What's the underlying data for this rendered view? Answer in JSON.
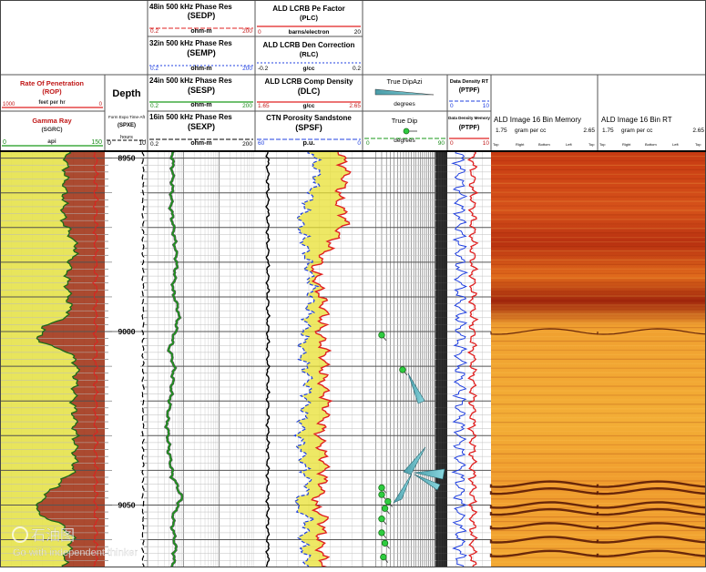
{
  "header": {
    "rop": {
      "title": "Rate Of Penetration",
      "mnemonic": "(ROP)",
      "unit": "feet per hr",
      "left": "1000",
      "right": "0",
      "color": "#e02020"
    },
    "gr": {
      "title": "Gamma Ray",
      "mnemonic": "(SGRC)",
      "unit": "api",
      "left": "0",
      "right": "150",
      "color": "#1a9a1a"
    },
    "depth_title": "Depth",
    "pore": {
      "title": "Form Expo Time-Aft",
      "mnemonic": "(SPXE)",
      "unit": "hours",
      "left": "0",
      "right": "10"
    },
    "sedp": {
      "title": "48in 500 kHz Phase Res",
      "mnemonic": "(SEDP)",
      "unit": "ohm-m",
      "left": "0.2",
      "right": "200",
      "color": "#e02020"
    },
    "semp": {
      "title": "32in 500 kHz Phase Res",
      "mnemonic": "(SEMP)",
      "unit": "ohm-m",
      "left": "0.2",
      "right": "200",
      "color": "#2040e0"
    },
    "sesp": {
      "title": "24in 500 kHz Phase Res",
      "mnemonic": "(SESP)",
      "unit": "ohm-m",
      "left": "0.2",
      "right": "200",
      "color": "#1a9a1a"
    },
    "sexp": {
      "title": "16in 500 kHz Phase Res",
      "mnemonic": "(SEXP)",
      "unit": "ohm-m",
      "left": "0.2",
      "right": "200",
      "color": "#000000"
    },
    "plc": {
      "title": "ALD LCRB Pe Factor",
      "mnemonic": "(PLC)",
      "unit": "barns/electron",
      "left": "0",
      "right": "20",
      "color": "#e02020"
    },
    "rlc": {
      "title": "ALD LCRB Den Correction",
      "mnemonic": "(RLC)",
      "unit": "g/cc",
      "left": "-0.2",
      "right": "0.2",
      "color": "#2040e0"
    },
    "dlc": {
      "title": "ALD LCRB Comp Density",
      "mnemonic": "(DLC)",
      "unit": "g/cc",
      "left": "1.65",
      "right": "2.65",
      "color": "#e02020"
    },
    "spsf": {
      "title": "CTN Porosity Sandstone",
      "mnemonic": "(SPSF)",
      "unit": "p.u.",
      "left": "60",
      "right": "0",
      "color": "#2040e0"
    },
    "dipazi": {
      "title": "True DipAzi",
      "unit": "degrees"
    },
    "truedip": {
      "title": "True Dip",
      "unit": "degrees",
      "left": "0",
      "right": "90"
    },
    "ptpf1": {
      "title": "Data Density RT",
      "mnemonic": "(PTPF)",
      "left": "0",
      "right": "10"
    },
    "ptpf2": {
      "title": "Data Density Memory",
      "mnemonic": "(PTPF)",
      "left": "0",
      "right": "10"
    },
    "img_mem": {
      "title": "ALD Image 16 Bin Memory",
      "left": "1.75",
      "unit": "gram per cc",
      "right": "2.65",
      "orient": [
        "Top",
        "Right",
        "Bottom",
        "Left",
        "Top"
      ]
    },
    "img_rt": {
      "title": "ALD Image 16 Bin RT",
      "left": "1.75",
      "unit": "gram per cc",
      "right": "2.65",
      "orient": [
        "Top",
        "Right",
        "Bottom",
        "Left",
        "Top"
      ]
    }
  },
  "watermark": {
    "brand": "石油图",
    "tagline": "Go with independent thinker"
  },
  "chart_data": {
    "type": "line",
    "depth_range": [
      8948,
      9068
    ],
    "depth_ticks": [
      {
        "depth": 8950,
        "label": "8950"
      },
      {
        "depth": 9000,
        "label": "9000"
      },
      {
        "depth": 9050,
        "label": "9050"
      }
    ],
    "gamma_ray": {
      "unit": "api",
      "range": [
        0,
        150
      ],
      "depth": [
        8948,
        8960,
        8968,
        8976,
        8980,
        8985,
        8990,
        8995,
        8999,
        9003,
        9006,
        9010,
        9020,
        9030,
        9040,
        9048,
        9052,
        9056,
        9060,
        9064,
        9068
      ],
      "values": [
        95,
        92,
        90,
        110,
        100,
        95,
        98,
        100,
        60,
        55,
        100,
        110,
        105,
        108,
        106,
        60,
        50,
        90,
        105,
        95,
        90
      ]
    },
    "phase_res_24in": {
      "unit": "ohm-m",
      "range": [
        0.2,
        200
      ],
      "depth": [
        8948,
        8956,
        8964,
        8972,
        8980,
        8988,
        8995,
        9000,
        9005,
        9010,
        9018,
        9026,
        9035,
        9042,
        9048,
        9052,
        9056,
        9062,
        9068
      ],
      "values": [
        1.0,
        1.0,
        0.9,
        1.1,
        1.3,
        1.0,
        1.5,
        1.2,
        0.8,
        1.1,
        0.9,
        0.7,
        0.8,
        1.0,
        1.8,
        1.1,
        1.0,
        1.2,
        1.0
      ]
    },
    "comp_density": {
      "unit": "g/cc",
      "range": [
        1.65,
        2.65
      ],
      "depth": [
        8948,
        8955,
        8962,
        8968,
        8975,
        8982,
        8988,
        8994,
        9000,
        9006,
        9014,
        9022,
        9030,
        9038,
        9045,
        9050,
        9054,
        9060,
        9068
      ],
      "values": [
        2.45,
        2.5,
        2.42,
        2.5,
        2.35,
        2.2,
        2.25,
        2.3,
        2.25,
        2.3,
        2.28,
        2.32,
        2.25,
        2.3,
        2.28,
        2.2,
        2.3,
        2.25,
        2.3
      ]
    },
    "porosity_sandstone": {
      "unit": "p.u.",
      "range": [
        60,
        0
      ],
      "depth": [
        8948,
        8955,
        8962,
        8968,
        8975,
        8982,
        8988,
        8994,
        9000,
        9006,
        9014,
        9022,
        9030,
        9038,
        9045,
        9050,
        9054,
        9060,
        9068
      ],
      "values": [
        28,
        25,
        30,
        35,
        32,
        30,
        28,
        30,
        32,
        34,
        30,
        32,
        35,
        33,
        30,
        38,
        30,
        34,
        30
      ]
    },
    "true_dip": {
      "unit": "degrees",
      "depth": [
        9001,
        9011,
        9045,
        9047,
        9049,
        9051,
        9054,
        9058,
        9061,
        9065
      ],
      "values": [
        6,
        23,
        6,
        6,
        10,
        8,
        6,
        6,
        8,
        7
      ]
    },
    "image_bands_depth": [
      9000,
      9044,
      9046,
      9050,
      9052,
      9056,
      9060,
      9064
    ]
  }
}
